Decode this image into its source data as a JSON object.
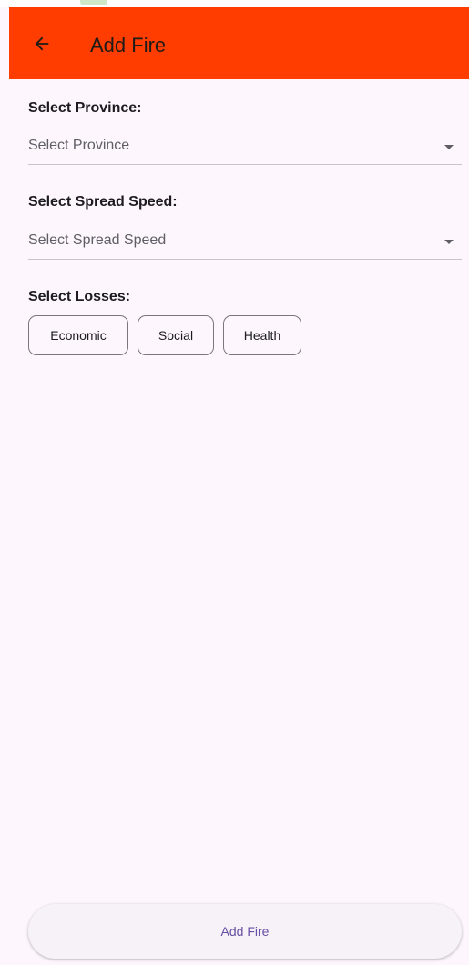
{
  "app_bar": {
    "back_icon": "arrow-left-icon",
    "title": "Add Fire",
    "color": "#ff3d00"
  },
  "province": {
    "label": "Select Province:",
    "placeholder": "Select Province",
    "icon": "dropdown-arrow-icon"
  },
  "spread_speed": {
    "label": "Select Spread Speed:",
    "placeholder": "Select Spread Speed",
    "icon": "dropdown-arrow-icon"
  },
  "losses": {
    "label": "Select Losses:",
    "chips": [
      "Economic",
      "Social",
      "Health"
    ]
  },
  "submit": {
    "label": "Add Fire",
    "color": "#6750a4"
  }
}
